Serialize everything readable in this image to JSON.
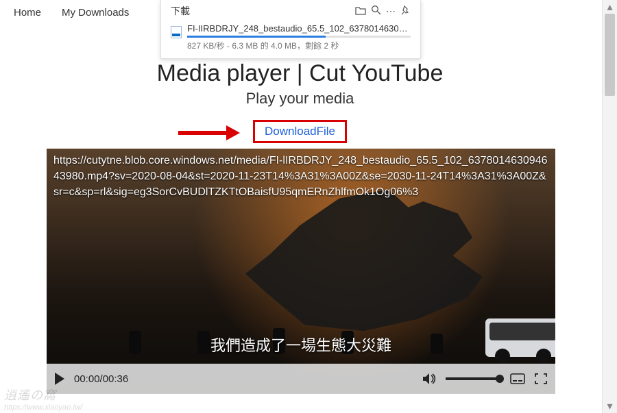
{
  "nav": {
    "home": "Home",
    "downloads": "My Downloads"
  },
  "panel": {
    "title": "下載",
    "file": "FI-IIRBDRJY_248_bestaudio_65.5_102_63780146309...",
    "stat": "827 KB/秒 - 6.3 MB 的 4.0 MB，剩餘 2 秒"
  },
  "page": {
    "title": "Media player | Cut YouTube",
    "sub": "Play your media",
    "download": "DownloadFile"
  },
  "video": {
    "url": "https://cutytne.blob.core.windows.net/media/FI-lIRBDRJY_248_bestaudio_65.5_102_637801463094643980.mp4?sv=2020-08-04&st=2020-11-23T14%3A31%3A00Z&se=2030-11-24T14%3A31%3A00Z&sr=c&sp=rl&sig=eg3SorCvBUDlTZKTtOBaisfU95qmERnZhlfmOk1Og06%3",
    "subtitle": "我們造成了一場生態大災難",
    "time": "00:00/00:36"
  },
  "watermark": {
    "name": "逍遙の窩",
    "url": "https://www.xiaoyao.tw/"
  }
}
